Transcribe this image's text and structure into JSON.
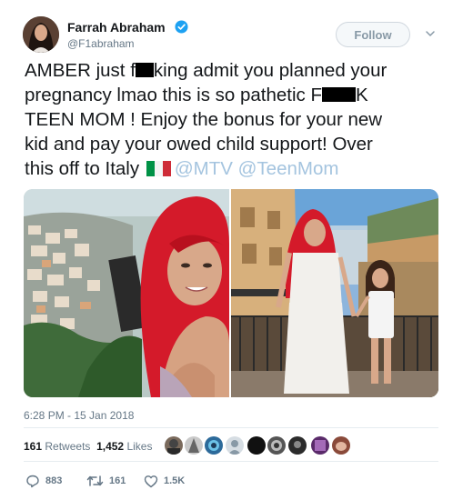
{
  "user": {
    "display_name": "Farrah Abraham",
    "handle": "@F1abraham",
    "verified": true
  },
  "follow_label": "Follow",
  "tweet": {
    "line1_a": "AMBER just f",
    "line1_b": "king admit you planned your",
    "line2_a": "pregnancy lmao this is so pathetic F",
    "line2_b": "K",
    "line3": "TEEN MOM ! Enjoy the bonus for your new",
    "line4": "kid and pay your owed child support! Over",
    "line5_text": "this off to Italy",
    "mention1": "@MTV",
    "mention2": "@TeenMom"
  },
  "timestamp": "6:28 PM - 15 Jan 2018",
  "stats": {
    "retweets_count": "161",
    "retweets_label": "Retweets",
    "likes_count": "1,452",
    "likes_label": "Likes"
  },
  "actions": {
    "replies": "883",
    "retweets": "161",
    "likes": "1.5K"
  },
  "colors": {
    "verified": "#1da1f2",
    "mention": "#a4c4df",
    "muted": "#657786",
    "flag_green": "#009246",
    "flag_red": "#ce2b37"
  },
  "icons": [
    "verified-badge-icon",
    "chevron-down-icon",
    "italy-flag-icon",
    "reply-icon",
    "retweet-icon",
    "like-icon"
  ]
}
